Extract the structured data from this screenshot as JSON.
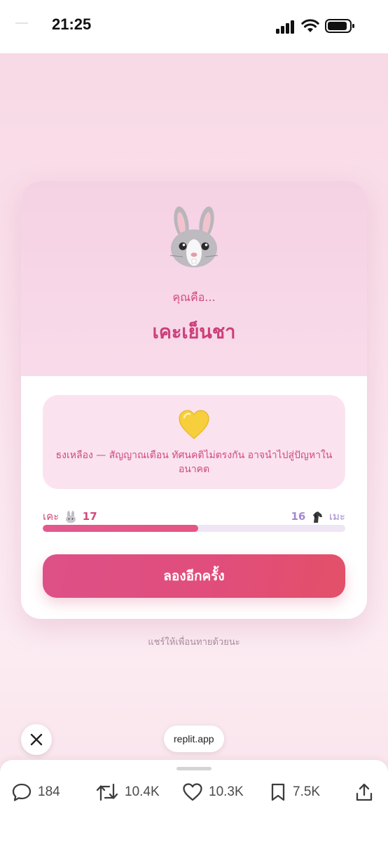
{
  "status_bar": {
    "time": "21:25"
  },
  "card": {
    "kicker": "คุณคือ...",
    "result_title": "เคะเย็นชา",
    "message": "ธงเหลือง — สัญญาณเตือน ทัศนคติไม่ตรงกัน อาจนำไปสู่ปัญหาในอนาคต",
    "score": {
      "left_label": "เคะ",
      "left_value": "17",
      "right_label": "เมะ",
      "right_value": "16",
      "left_fraction": 0.515
    },
    "retry_label": "ลองอีกครั้ง"
  },
  "share_text": "แชร์ให้เพื่อนทายด้วยนะ",
  "source_pill": "replit.app",
  "actions": {
    "replies": "184",
    "reposts": "10.4K",
    "likes": "10.3K",
    "bookmarks": "7.5K"
  },
  "colors": {
    "accent": "#d2497e",
    "accent_secondary": "#a588cf",
    "button_gradient_start": "#dd5187",
    "button_gradient_end": "#e25068"
  }
}
